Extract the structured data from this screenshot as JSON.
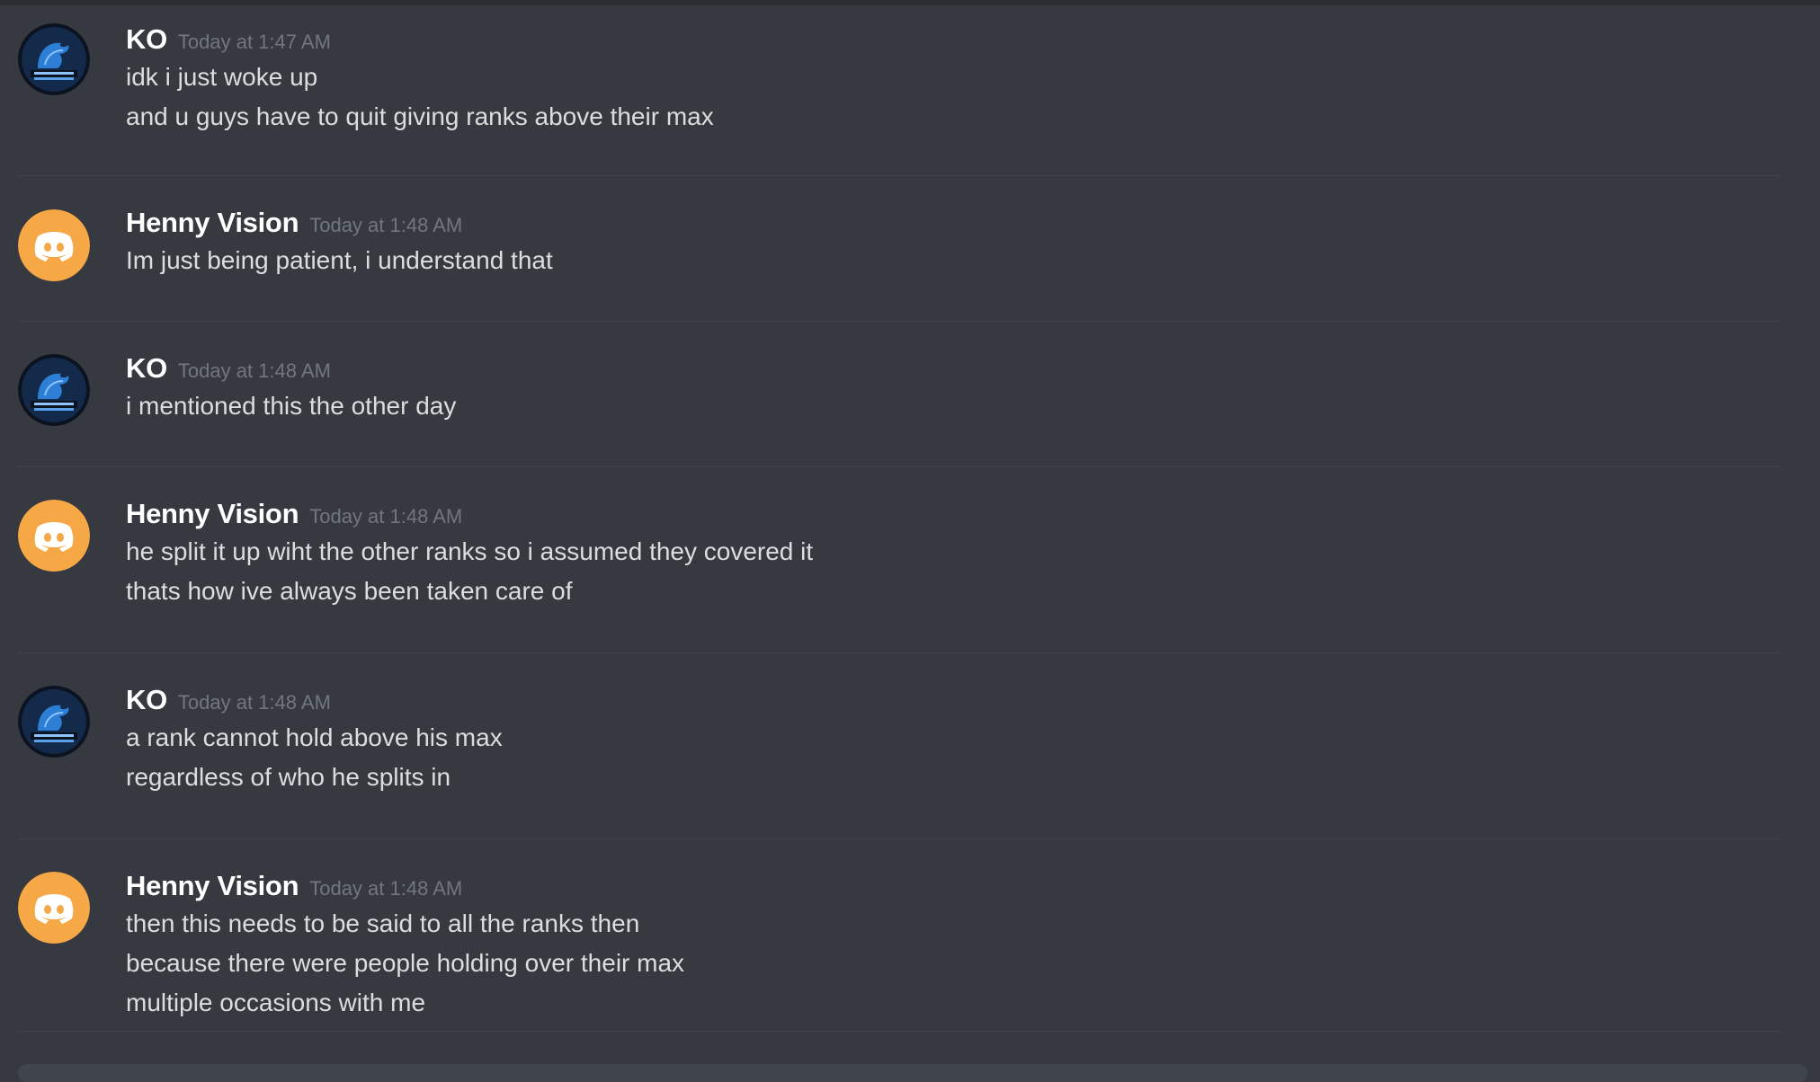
{
  "messages": [
    {
      "author": "KO",
      "avatar": "dragon-avatar",
      "timestamp": "Today at 1:47 AM",
      "lines": [
        "idk i just woke up",
        "and u guys have to quit giving ranks above their max"
      ]
    },
    {
      "author": "Henny Vision",
      "avatar": "discord-default-avatar",
      "timestamp": "Today at 1:48 AM",
      "lines": [
        "Im just being patient, i understand that"
      ]
    },
    {
      "author": "KO",
      "avatar": "dragon-avatar",
      "timestamp": "Today at 1:48 AM",
      "lines": [
        "i mentioned this the other day"
      ]
    },
    {
      "author": "Henny Vision",
      "avatar": "discord-default-avatar",
      "timestamp": "Today at 1:48 AM",
      "lines": [
        "he split it up wiht the other ranks so i assumed they covered it",
        "thats how ive always been taken care of"
      ]
    },
    {
      "author": "KO",
      "avatar": "dragon-avatar",
      "timestamp": "Today at 1:48 AM",
      "lines": [
        "a rank cannot hold above his max",
        "regardless of who he splits in"
      ]
    },
    {
      "author": "Henny Vision",
      "avatar": "discord-default-avatar",
      "timestamp": "Today at 1:48 AM",
      "lines": [
        "then this needs to be said to all the ranks then",
        "because there were people holding over their max",
        "multiple occasions with me"
      ]
    }
  ],
  "colors": {
    "background": "#36393f",
    "username": "#ffffff",
    "timestamp": "#72767d",
    "text": "#dcddde",
    "discord_avatar": "#f5a845",
    "divider": "#40434a"
  }
}
